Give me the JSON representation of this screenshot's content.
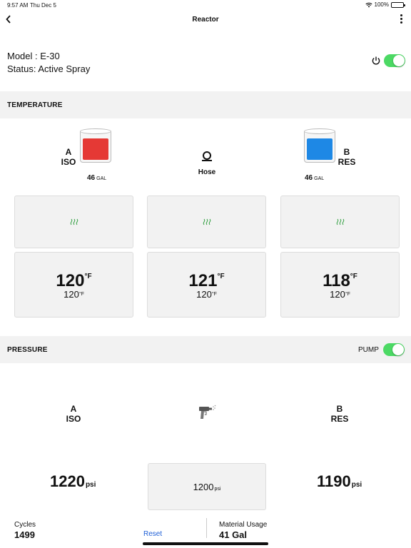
{
  "status_bar": {
    "time": "9:57 AM",
    "date": "Thu Dec 5",
    "battery": "100%",
    "wifi_icon": "wifi-icon",
    "battery_icon": "battery-icon"
  },
  "nav": {
    "title": "Reactor",
    "back_icon": "chevron-left-icon",
    "more_icon": "more-vertical-icon"
  },
  "info": {
    "model": "Model : E-30",
    "status": "Status: Active Spray",
    "power_icon": "power-icon",
    "power_on": true
  },
  "temperature": {
    "header": "TEMPERATURE",
    "iso": {
      "letter": "A",
      "name": "ISO",
      "gallons": "46",
      "unit": "GAL",
      "color": "#e53935"
    },
    "res": {
      "letter": "B",
      "name": "RES",
      "gallons": "46",
      "unit": "GAL",
      "color": "#1e88e5"
    },
    "hose_label": "Hose",
    "heater_icon": "heater-icon",
    "heater_color": "#2e9e3e",
    "zones": [
      {
        "actual": "120",
        "unit": "°F",
        "setpoint": "120",
        "set_unit": "°F"
      },
      {
        "actual": "121",
        "unit": "°F",
        "setpoint": "120",
        "set_unit": "°F"
      },
      {
        "actual": "118",
        "unit": "°F",
        "setpoint": "120",
        "set_unit": "°F"
      }
    ]
  },
  "pressure": {
    "header": "PRESSURE",
    "pump_label": "PUMP",
    "pump_on": true,
    "iso": {
      "letter": "A",
      "name": "ISO",
      "value": "1220",
      "unit": "psi"
    },
    "res": {
      "letter": "B",
      "name": "RES",
      "value": "1190",
      "unit": "psi"
    },
    "setpoint": {
      "value": "1200",
      "unit": "psi"
    },
    "gun_icon": "spray-gun-icon"
  },
  "footer": {
    "cycles_label": "Cycles",
    "cycles_value": "1499",
    "reset_label": "Reset",
    "material_label": "Material Usage",
    "material_value": "41 Gal"
  },
  "colors": {
    "toggle_on": "#4cd964",
    "link": "#1e5fd6",
    "section_bg": "#f2f2f2"
  }
}
